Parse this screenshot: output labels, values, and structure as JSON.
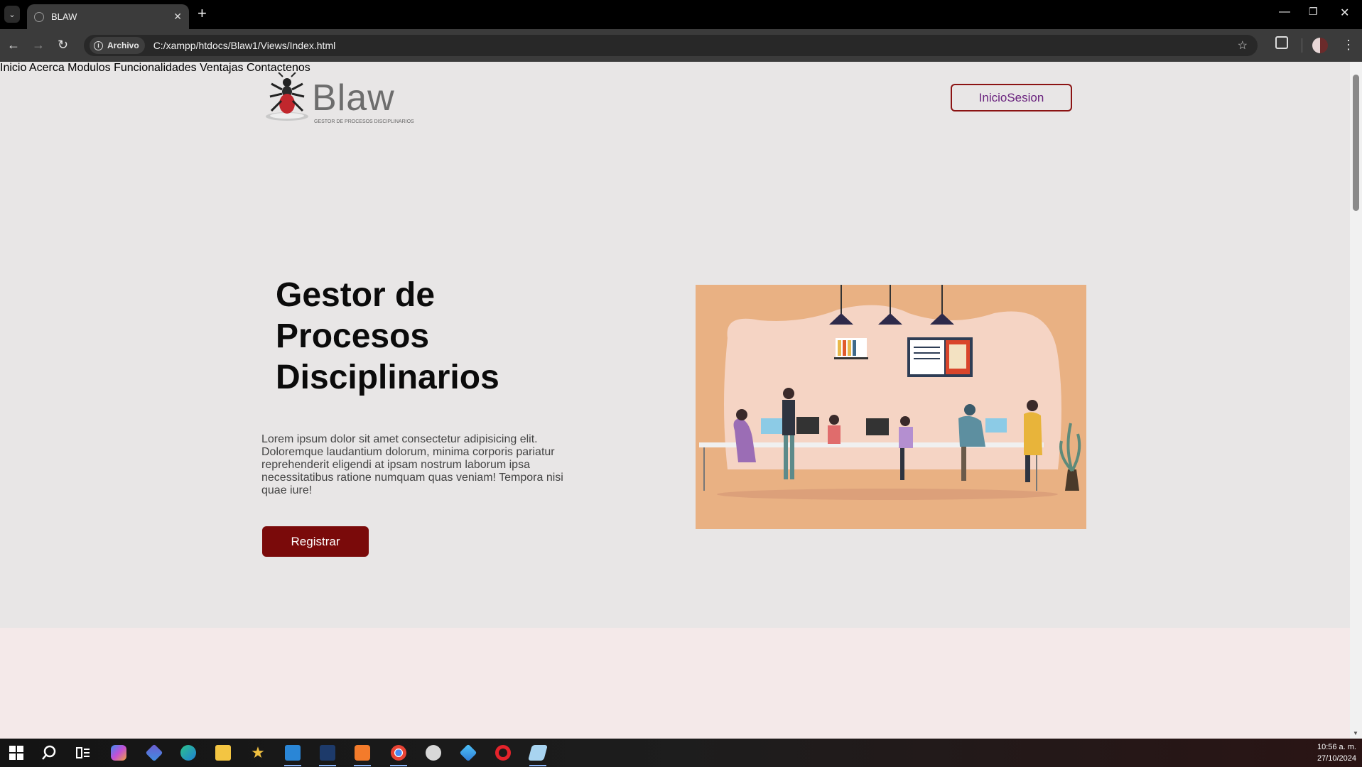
{
  "browser": {
    "tab_title": "BLAW",
    "site_chip": "Archivo",
    "url": "C:/xampp/htdocs/Blaw1/Views/Index.html"
  },
  "page": {
    "logo_word": "Blaw",
    "logo_tagline": "GESTOR DE PROCESOS DISCIPLINARIOS",
    "nav": [
      "Inicio",
      "Acerca",
      "Modulos",
      "Funcionalidades",
      "Ventajas",
      "Contactenos"
    ],
    "login_label": "InicioSesion",
    "hero_title_lines": [
      "Gestor de",
      "Procesos",
      "Disciplinarios"
    ],
    "hero_text": "Lorem ipsum dolor sit amet consectetur adipisicing elit. Doloremque laudantium dolorum, minima corporis pariatur reprehenderit eligendi at ipsam nostrum laborum ipsa necessitatibus ratione numquam quas veniam! Tempora nisi quae iure!",
    "register_label": "Registrar"
  },
  "taskbar": {
    "time": "10:56 a. m.",
    "date": "27/10/2024"
  },
  "colors": {
    "accent": "#7a0a0a",
    "login_text": "#6a237e",
    "page_bg": "#e8e6e6",
    "illustration_bg": "#e9b183"
  }
}
